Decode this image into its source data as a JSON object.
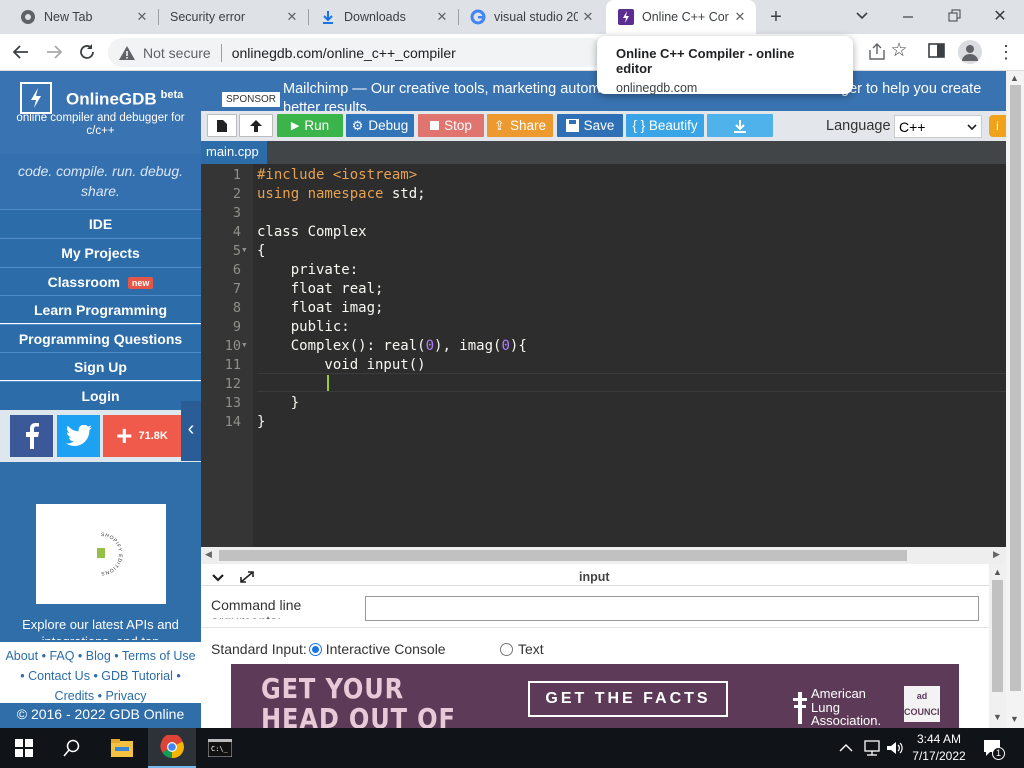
{
  "browser": {
    "tabs": [
      {
        "title": "New Tab",
        "icon": "chrome-icon"
      },
      {
        "title": "Security error",
        "icon": "blank-icon"
      },
      {
        "title": "Downloads",
        "icon": "download-icon"
      },
      {
        "title": "visual studio 20",
        "icon": "google-icon"
      },
      {
        "title": "Online C++ Cor",
        "icon": "onlinegdb-icon",
        "active": true
      }
    ],
    "security_label": "Not secure",
    "url": "onlinegdb.com/online_c++_compiler",
    "hover_card": {
      "title": "Online C++ Compiler - online editor",
      "domain": "onlinegdb.com"
    }
  },
  "sidebar": {
    "brand": "OnlineGDB",
    "brand_sup": "beta",
    "brand_sub": "online compiler and debugger for c/c++",
    "tagline": "code. compile. run. debug. share.",
    "nav": [
      {
        "label": "IDE"
      },
      {
        "label": "My Projects"
      },
      {
        "label": "Classroom",
        "badge": "new"
      },
      {
        "label": "Learn Programming"
      },
      {
        "label": "Programming Questions"
      },
      {
        "label": "Sign Up"
      },
      {
        "label": "Login"
      }
    ],
    "share_count": "71.8K",
    "ad_text": "Explore our latest APIs and integrations, and tap",
    "ad_badge_text": "SHOPIFY EDITIONS",
    "footer_links": [
      "About",
      "FAQ",
      "Blog",
      "Terms of Use",
      "Contact Us",
      "GDB Tutorial",
      "Credits",
      "Privacy"
    ],
    "copyright": "© 2016 - 2022 GDB Online"
  },
  "sponsor": {
    "label": "SPONSOR",
    "text": "Mailchimp — Our creative tools, marketing automa",
    "text_right": "ger to help you create",
    "text_line2": "better results."
  },
  "toolbar": {
    "run": "Run",
    "debug": "Debug",
    "stop": "Stop",
    "share": "Share",
    "save": "Save",
    "beautify": "{ } Beautify",
    "language_label": "Language",
    "language_value": "C++"
  },
  "file_tab": "main.cpp",
  "editor": {
    "line_numbers": [
      "1",
      "2",
      "3",
      "4",
      "5",
      "6",
      "7",
      "8",
      "9",
      "10",
      "11",
      "12",
      "13",
      "14"
    ],
    "fold_lines": [
      "5",
      "10"
    ]
  },
  "io": {
    "title": "input",
    "cmd_label": "Command line arguments:",
    "std_input_label": "Standard Input:",
    "opt_interactive": "Interactive Console",
    "opt_text": "Text"
  },
  "banner_ad": {
    "headline": "GET YOUR HEAD OUT OF THE CLOUD",
    "cta": "GET THE FACTS",
    "org": "American Lung Association.",
    "logo": "ad COUNCIL"
  },
  "taskbar": {
    "time": "3:44 AM",
    "date": "7/17/2022",
    "notifications": "1"
  },
  "colors": {
    "brand_blue": "#3a73b1",
    "run_green": "#3bb54a",
    "debug_blue": "#3274b8",
    "stop_red": "#e0615a",
    "share_orange": "#ec9a30",
    "save_blue": "#2f6fb5",
    "beautify_blue": "#3aa5e6",
    "editor_bg": "#2d2d2d"
  }
}
